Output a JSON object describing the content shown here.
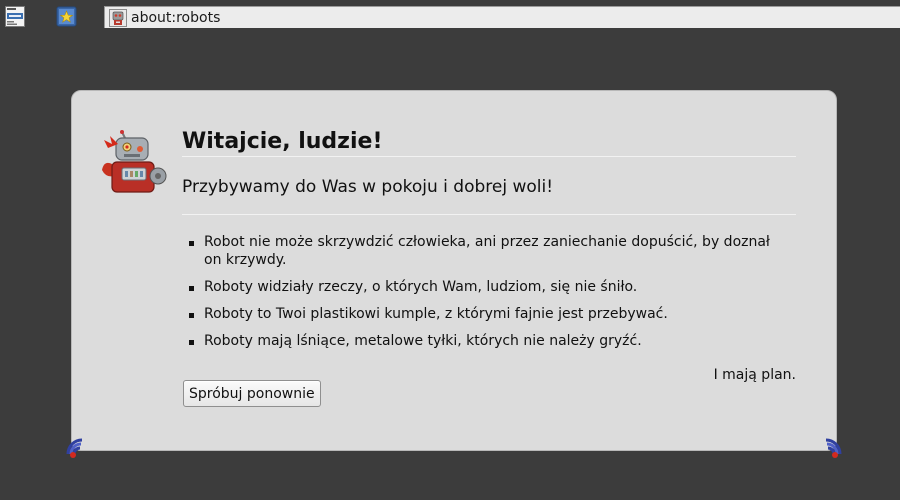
{
  "toolbar": {
    "icons": [
      "news-feed-icon",
      "bookmark-star-icon"
    ]
  },
  "urlbar": {
    "favicon": "robot-icon",
    "url": "about:robots"
  },
  "card": {
    "title": "Witajcie, ludzie!",
    "subtitle": "Przybywamy do Was w pokoju i dobrej woli!",
    "laws": [
      "Robot nie może skrzywdzić człowieka, ani przez zaniechanie dopuścić, by doznał on krzywdy.",
      "Roboty widziały rzeczy, o których Wam, ludziom, się nie śniło.",
      "Roboty to Twoi plastikowi kumple, z którymi fajnie jest przebywać.",
      "Roboty mają lśniące, metalowe tyłki, których nie należy gryźć."
    ],
    "plan": "I mają plan.",
    "retry_label": "Spróbuj ponownie",
    "robot_image": "robot-icon",
    "corner_icons": [
      "antenna-signal-icon",
      "antenna-signal-icon"
    ]
  },
  "colors": {
    "background": "#3c3c3c",
    "card": "#dcdcdc",
    "urlbar": "#ececec"
  }
}
